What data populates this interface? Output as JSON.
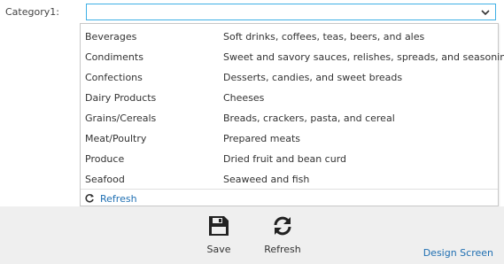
{
  "form": {
    "category_label": "Category1:",
    "combo_value": ""
  },
  "dropdown": {
    "rows": [
      {
        "name": "Beverages",
        "description": "Soft drinks, coffees, teas, beers, and ales"
      },
      {
        "name": "Condiments",
        "description": "Sweet and savory sauces, relishes, spreads, and seasonings"
      },
      {
        "name": "Confections",
        "description": "Desserts, candies, and sweet breads"
      },
      {
        "name": "Dairy Products",
        "description": "Cheeses"
      },
      {
        "name": "Grains/Cereals",
        "description": "Breads, crackers, pasta, and cereal"
      },
      {
        "name": "Meat/Poultry",
        "description": "Prepared meats"
      },
      {
        "name": "Produce",
        "description": "Dried fruit and bean curd"
      },
      {
        "name": "Seafood",
        "description": "Seaweed and fish"
      }
    ],
    "refresh_label": "Refresh"
  },
  "commands": {
    "save_label": "Save",
    "refresh_label": "Refresh",
    "save_icon": "floppy-disk-icon",
    "refresh_icon": "refresh-icon"
  },
  "footer": {
    "design_screen_label": "Design Screen"
  },
  "colors": {
    "accent": "#3fb0e6",
    "link": "#1f6fb2",
    "footer_bg": "#efefef"
  }
}
